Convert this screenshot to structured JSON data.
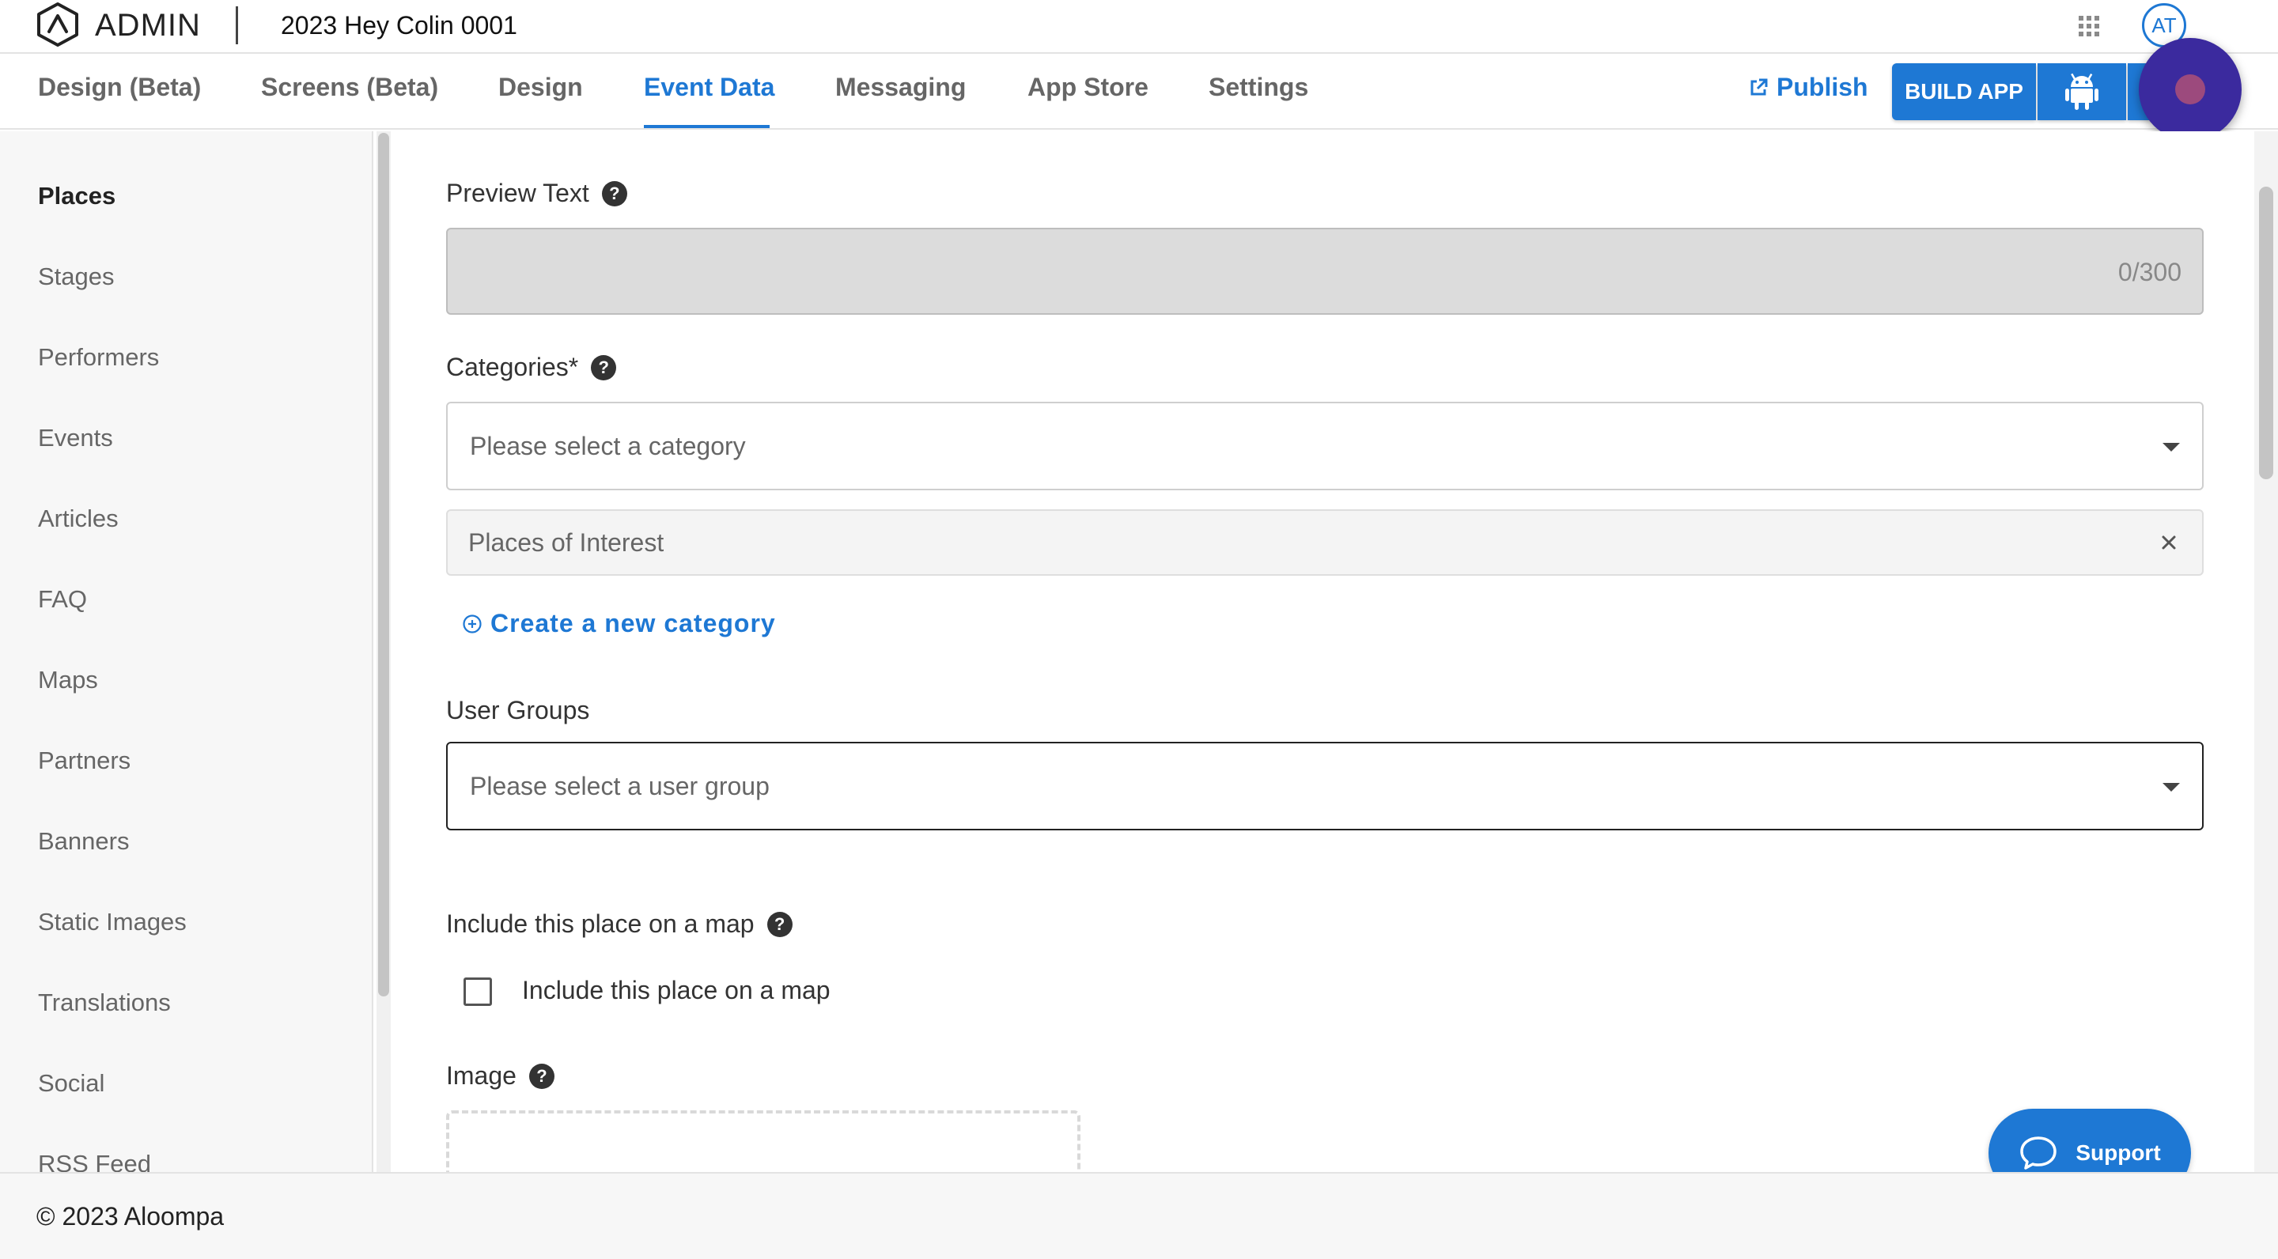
{
  "header": {
    "brand": "ADMIN",
    "app_title": "2023 Hey Colin 0001",
    "avatar_initials": "AT"
  },
  "nav": {
    "tabs": [
      {
        "label": "Design (Beta)",
        "active": false
      },
      {
        "label": "Screens (Beta)",
        "active": false
      },
      {
        "label": "Design",
        "active": false
      },
      {
        "label": "Event Data",
        "active": true
      },
      {
        "label": "Messaging",
        "active": false
      },
      {
        "label": "App Store",
        "active": false
      },
      {
        "label": "Settings",
        "active": false
      }
    ],
    "publish_label": "Publish",
    "build_label": "BUILD APP"
  },
  "sidebar": {
    "items": [
      {
        "label": "Places",
        "active": true
      },
      {
        "label": "Stages"
      },
      {
        "label": "Performers"
      },
      {
        "label": "Events"
      },
      {
        "label": "Articles"
      },
      {
        "label": "FAQ"
      },
      {
        "label": "Maps"
      },
      {
        "label": "Partners"
      },
      {
        "label": "Banners"
      },
      {
        "label": "Static Images"
      },
      {
        "label": "Translations"
      },
      {
        "label": "Social"
      },
      {
        "label": "RSS Feed"
      }
    ]
  },
  "form": {
    "preview_text": {
      "label": "Preview Text",
      "counter": "0/300"
    },
    "categories": {
      "label": "Categories*",
      "placeholder": "Please select a category",
      "selected_chip": "Places of Interest",
      "create_link": "Create a new category"
    },
    "user_groups": {
      "label": "User Groups",
      "placeholder": "Please select a user group"
    },
    "map": {
      "label": "Include this place on a map",
      "checkbox_label": "Include this place on a map",
      "checked": false
    },
    "image": {
      "label": "Image"
    }
  },
  "support": {
    "label": "Support"
  },
  "footer": {
    "copyright": "© 2023 Aloompa"
  },
  "colors": {
    "accent": "#1e78d4",
    "record_button": "#3b2a9e"
  }
}
